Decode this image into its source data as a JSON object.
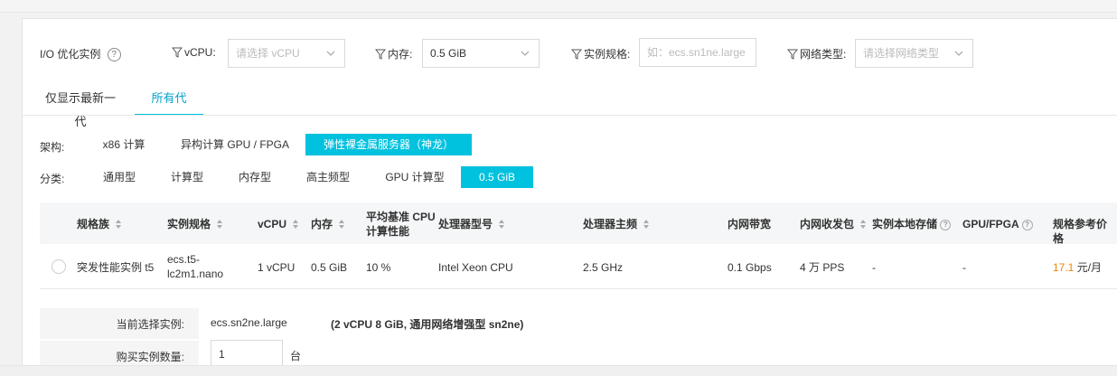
{
  "filters": {
    "io_optimized": {
      "label": "I/O 优化实例",
      "icon": "help-circle-icon"
    },
    "vcpu": {
      "label": "vCPU:",
      "placeholder": "请选择 vCPU"
    },
    "memory": {
      "label": "内存:",
      "value": "0.5 GiB"
    },
    "instance_spec": {
      "label": "实例规格:",
      "placeholder": "如：ecs.sn1ne.large"
    },
    "network_type": {
      "label": "网络类型:",
      "placeholder": "请选择网络类型"
    }
  },
  "tabs": [
    {
      "label": "仅显示最新一代",
      "active": false
    },
    {
      "label": "所有代",
      "active": true
    }
  ],
  "architecture": {
    "label": "架构:",
    "options": [
      {
        "label": "x86 计算",
        "selected": false
      },
      {
        "label": "异构计算 GPU / FPGA",
        "selected": false
      },
      {
        "label": "弹性裸金属服务器（神龙）",
        "selected": true
      }
    ]
  },
  "category": {
    "label": "分类:",
    "options": [
      {
        "label": "通用型",
        "selected": false
      },
      {
        "label": "计算型",
        "selected": false
      },
      {
        "label": "内存型",
        "selected": false
      },
      {
        "label": "高主频型",
        "selected": false
      },
      {
        "label": "GPU 计算型",
        "selected": false
      },
      {
        "label": "0.5 GiB",
        "selected": true
      }
    ]
  },
  "table": {
    "headers": {
      "family": "规格族",
      "spec": "实例规格",
      "vcpu": "vCPU",
      "memory": "内存",
      "baseline_line1": "平均基准 CPU",
      "baseline_line2": "计算性能",
      "processor": "处理器型号",
      "frequency": "处理器主频",
      "bandwidth": "内网带宽",
      "pps": "内网收发包",
      "local_storage": "实例本地存储",
      "gpu_fpga": "GPU/FPGA",
      "price": "规格参考价格"
    },
    "rows": [
      {
        "family": "突发性能实例 t5",
        "spec_line1": "ecs.t5-",
        "spec_line2": "lc2m1.nano",
        "vcpu": "1 vCPU",
        "memory": "0.5 GiB",
        "baseline": "10 %",
        "processor": "Intel Xeon CPU",
        "frequency": "2.5 GHz",
        "bandwidth": "0.1 Gbps",
        "pps": "4 万 PPS",
        "local_storage": "-",
        "gpu_fpga": "-",
        "price_value": "17.1",
        "price_unit": " 元/月"
      }
    ]
  },
  "summary": {
    "current_label": "当前选择实例:",
    "current_value": "ecs.sn2ne.large",
    "current_detail": "(2 vCPU 8 GiB, 通用网络增强型 sn2ne)",
    "quantity_label": "购买实例数量:",
    "quantity_value": "1",
    "quantity_unit": "台"
  },
  "colors": {
    "accent": "#00c1de",
    "price": "#f08300"
  }
}
